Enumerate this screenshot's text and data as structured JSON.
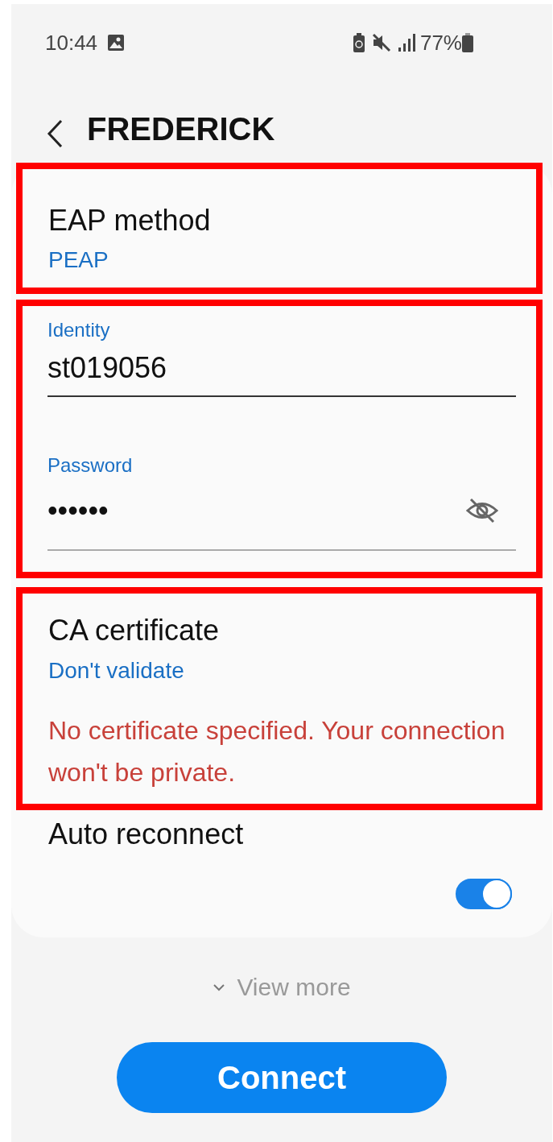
{
  "status_bar": {
    "time": "10:44",
    "battery": "77%"
  },
  "header": {
    "title": "FREDERICK"
  },
  "groups": [
    {
      "kind": "setting",
      "highlighted": true,
      "label": "EAP method",
      "value": "PEAP"
    },
    {
      "kind": "credentials",
      "highlighted": true,
      "fields": [
        {
          "kind": "text",
          "label": "Identity",
          "value": "st019056"
        },
        {
          "kind": "password",
          "label": "Password",
          "value": "••••••"
        }
      ]
    },
    {
      "kind": "certificate",
      "highlighted": true,
      "label": "CA certificate",
      "value": "Don't validate",
      "warning": "No certificate specified. Your connection won't be private."
    },
    {
      "kind": "toggle",
      "highlighted": false,
      "label": "Auto reconnect",
      "on": true
    }
  ],
  "view_more": "View more",
  "connect_button": "Connect"
}
